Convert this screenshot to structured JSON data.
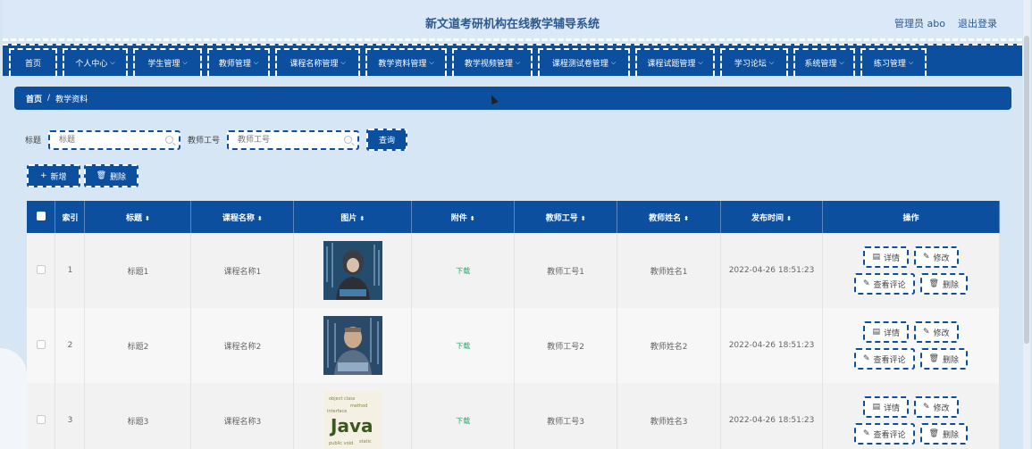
{
  "header": {
    "title": "新文道考研机构在线教学辅导系统",
    "user": "管理员 abo",
    "logout": "退出登录"
  },
  "nav": [
    "首页",
    "个人中心",
    "学生管理",
    "教师管理",
    "课程名称管理",
    "教学资料管理",
    "教学视频管理",
    "课程测试卷管理",
    "课程试题管理",
    "学习论坛",
    "系统管理",
    "练习管理"
  ],
  "breadcrumb": {
    "home": "首页",
    "sep": "/",
    "current": "教学资料"
  },
  "search": {
    "label_title": "标题",
    "placeholder_title": "标题",
    "label_teacher": "教师工号",
    "placeholder_teacher": "教师工号",
    "button": "查询"
  },
  "toolbar": {
    "add": "新增",
    "delete": "删除"
  },
  "table": {
    "headers": [
      "索引",
      "标题",
      "课程名称",
      "图片",
      "附件",
      "教师工号",
      "教师姓名",
      "发布时间",
      "操作"
    ],
    "rows": [
      {
        "index": "1",
        "title": "标题1",
        "course": "课程名称1",
        "attach": "下载",
        "teacher_id": "教师工号1",
        "teacher_name": "教师姓名1",
        "time": "2022-04-26 18:51:23"
      },
      {
        "index": "2",
        "title": "标题2",
        "course": "课程名称2",
        "attach": "下载",
        "teacher_id": "教师工号2",
        "teacher_name": "教师姓名2",
        "time": "2022-04-26 18:51:23"
      },
      {
        "index": "3",
        "title": "标题3",
        "course": "课程名称3",
        "attach": "下载",
        "teacher_id": "教师工号3",
        "teacher_name": "教师姓名3",
        "time": "2022-04-26 18:51:23"
      }
    ],
    "ops": {
      "detail": "详情",
      "edit": "修改",
      "comments": "查看评论",
      "delete": "删除"
    }
  },
  "thumb3_text": "Java",
  "colors": {
    "primary": "#0b4f9e",
    "background": "#d6e6f5",
    "download": "#2aa56a"
  }
}
